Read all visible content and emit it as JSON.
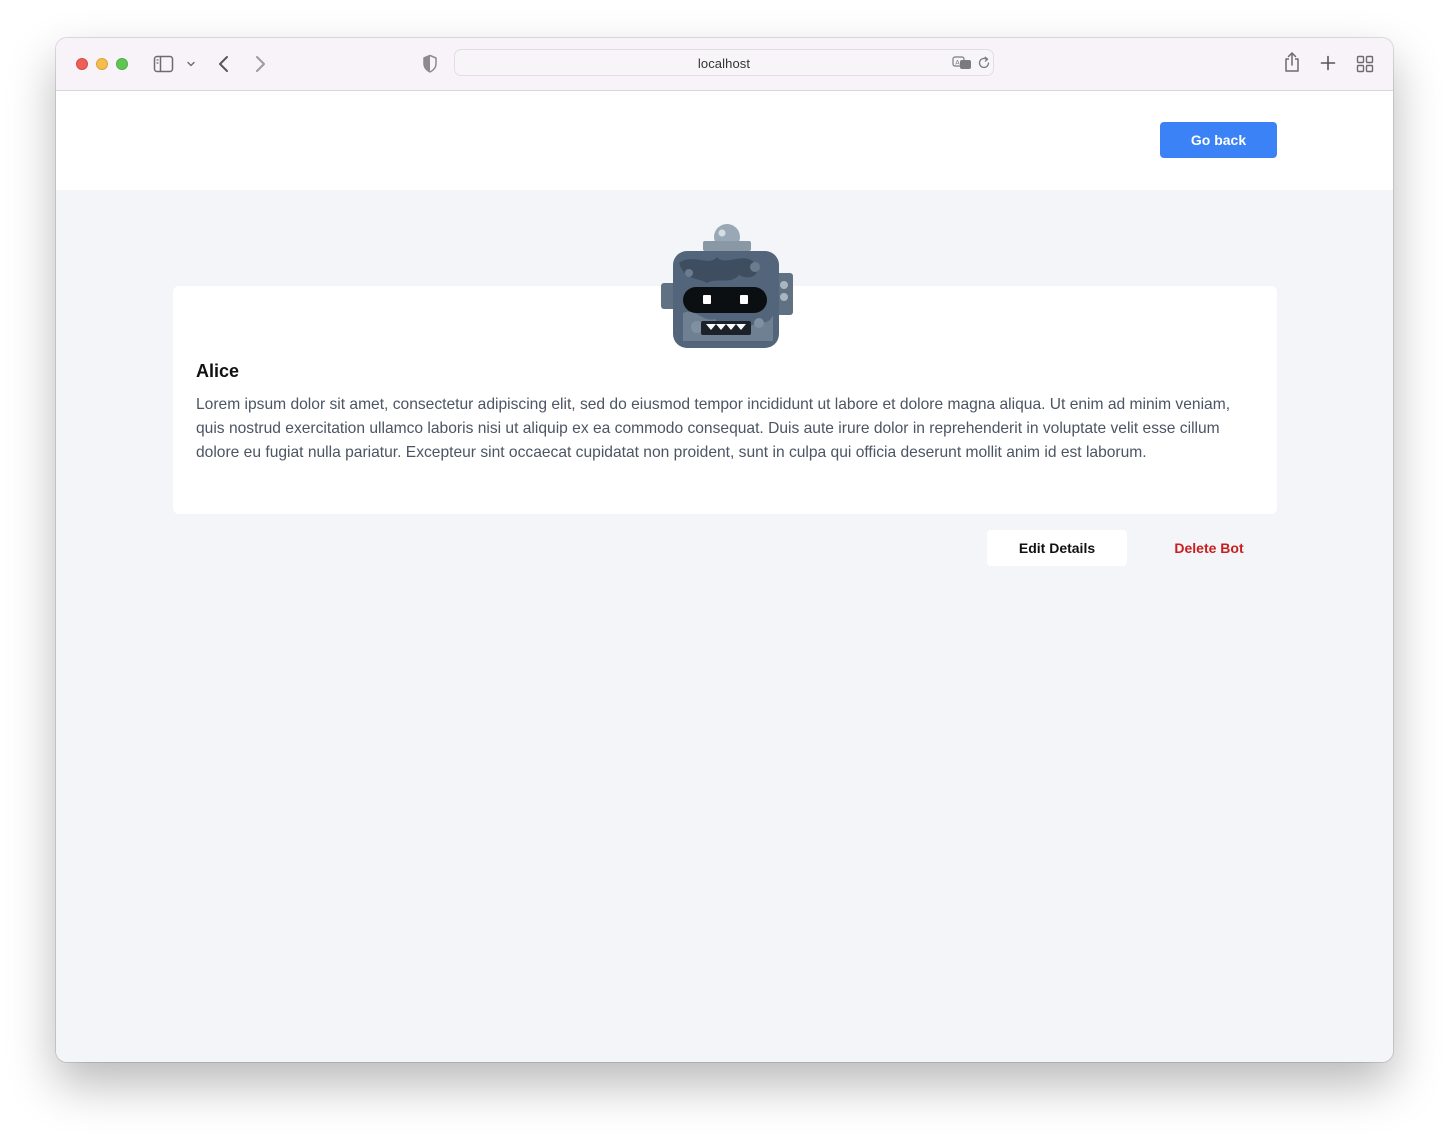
{
  "browser": {
    "url": "localhost",
    "traffic_lights": [
      "close",
      "minimize",
      "zoom"
    ],
    "toolbar_icons": [
      "sidebar-toggle-icon",
      "chevron-down-icon",
      "back-arrow-icon",
      "forward-arrow-icon",
      "privacy-shield-icon",
      "translate-icon",
      "reload-icon",
      "share-icon",
      "new-tab-plus-icon",
      "tab-overview-icon"
    ]
  },
  "header": {
    "go_back_label": "Go back"
  },
  "bot": {
    "name": "Alice",
    "description": "Lorem ipsum dolor sit amet, consectetur adipiscing elit, sed do eiusmod tempor incididunt ut labore et dolore magna aliqua. Ut enim ad minim veniam, quis nostrud exercitation ullamco laboris nisi ut aliquip ex ea commodo consequat. Duis aute irure dolor in reprehenderit in voluptate velit esse cillum dolore eu fugiat nulla pariatur. Excepteur sint occaecat cupidatat non proident, sunt in culpa qui officia deserunt mollit anim id est laborum."
  },
  "actions": {
    "edit_label": "Edit Details",
    "delete_label": "Delete Bot"
  },
  "colors": {
    "primary": "#3b82f6",
    "danger": "#c81e1e",
    "page_background": "#f4f5f9",
    "card_background": "#ffffff",
    "body_text": "#4b5563"
  }
}
